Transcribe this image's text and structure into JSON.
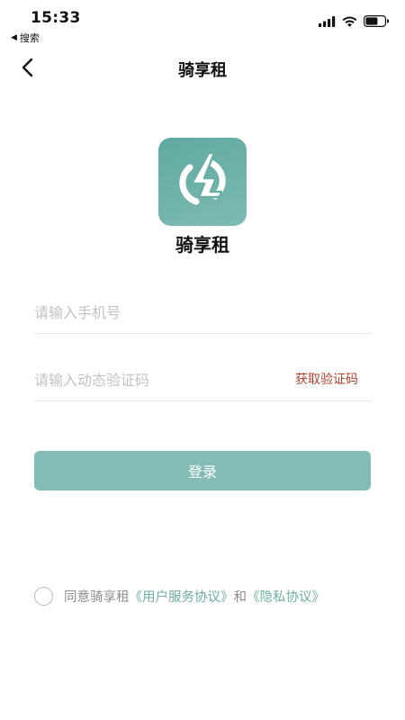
{
  "status_bar": {
    "time": "15:33",
    "back_app_label": "搜索",
    "icons": [
      "cellular-signal-icon",
      "wifi-icon",
      "battery-icon"
    ]
  },
  "nav": {
    "title": "骑享租",
    "back_icon": "chevron-left-icon"
  },
  "logo": {
    "icon": "lightning-bolt-icon",
    "app_name": "骑享租",
    "colors": {
      "background": "#6aaea5",
      "glyph": "#ffffff"
    }
  },
  "form": {
    "phone_placeholder": "请输入手机号",
    "phone_value": "",
    "code_placeholder": "请输入动态验证码",
    "code_value": "",
    "get_code_label": "获取验证码",
    "login_label": "登录"
  },
  "agreement": {
    "prefix": "同意骑享租",
    "user_agreement": "《用户服务协议》",
    "and": "和",
    "privacy_policy": "《隐私协议》",
    "checked": false
  },
  "colors": {
    "accent": "#82bcb4",
    "link": "#6faea5",
    "get_code": "#b4402e"
  }
}
